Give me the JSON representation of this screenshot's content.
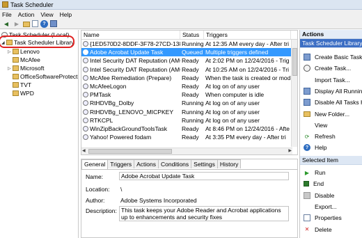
{
  "window": {
    "title": "Task Scheduler"
  },
  "menu": [
    "File",
    "Action",
    "View",
    "Help"
  ],
  "tree": {
    "root": "Task Scheduler (Local)",
    "library": "Task Scheduler Library",
    "children": [
      "Lenovo",
      "McAfee",
      "Microsoft",
      "OfficeSoftwareProtect",
      "TVT",
      "WPD"
    ]
  },
  "list": {
    "headers": {
      "name": "Name",
      "status": "Status",
      "triggers": "Triggers"
    },
    "rows": [
      {
        "name": "{1ED570D2-8DDF-3F78-27CD-1385...",
        "status": "Running",
        "triggers": "At 12:35 AM every day - After tri"
      },
      {
        "name": "Adobe Acrobat Update Task",
        "status": "Queued",
        "triggers": "Multiple triggers defined"
      },
      {
        "name": "Intel Security DAT Reputation (AMC...",
        "status": "Ready",
        "triggers": "At 2:02 PM on 12/24/2016 - Trig"
      },
      {
        "name": "Intel Security DAT Reputation (AMC...",
        "status": "Ready",
        "triggers": "At 10:25 AM on 12/24/2016 - Tri"
      },
      {
        "name": "McAfee Remediation (Prepare)",
        "status": "Ready",
        "triggers": "When the task is created or mod"
      },
      {
        "name": "McAfeeLogon",
        "status": "Ready",
        "triggers": "At log on of any user"
      },
      {
        "name": "PMTask",
        "status": "Ready",
        "triggers": "When computer is idle"
      },
      {
        "name": "RtHDVBg_Dolby",
        "status": "Running",
        "triggers": "At log on of any user"
      },
      {
        "name": "RtHDVBg_LENOVO_MICPKEY",
        "status": "Running",
        "triggers": "At log on of any user"
      },
      {
        "name": "RTKCPL",
        "status": "Running",
        "triggers": "At log on of any user"
      },
      {
        "name": "WinZipBackGroundToolsTask",
        "status": "Ready",
        "triggers": "At 8:46 PM on 12/24/2016 - Afte"
      },
      {
        "name": "Yahoo! Powered fodam",
        "status": "Ready",
        "triggers": "At 3:35 PM every day - After tri"
      }
    ],
    "selected_index": 1
  },
  "details": {
    "tabs": [
      "General",
      "Triggers",
      "Actions",
      "Conditions",
      "Settings",
      "History"
    ],
    "active_tab": "General",
    "name_label": "Name:",
    "name_value": "Adobe Acrobat Update Task",
    "location_label": "Location:",
    "location_value": "\\",
    "author_label": "Author:",
    "author_value": "Adobe Systems Incorporated",
    "description_label": "Description:",
    "description_value": "This task keeps your Adobe Reader and Acrobat applications up to enhancements and security fixes"
  },
  "actions": {
    "header": "Actions",
    "section_library": "Task Scheduler Library",
    "library_items": [
      {
        "label": "Create Basic Task...",
        "icon": "basic-task-icon"
      },
      {
        "label": "Create Task...",
        "icon": "create-task-icon"
      },
      {
        "label": "Import Task...",
        "icon": "none"
      },
      {
        "label": "Display All Running",
        "icon": "display-running-icon"
      },
      {
        "label": "Disable All Tasks Hi",
        "icon": "disable-history-icon"
      },
      {
        "label": "New Folder...",
        "icon": "folder-icon"
      },
      {
        "label": "View",
        "icon": "none"
      },
      {
        "label": "Refresh",
        "icon": "refresh-icon"
      },
      {
        "label": "Help",
        "icon": "help-icon"
      }
    ],
    "section_selected": "Selected Item",
    "selected_items": [
      {
        "label": "Run",
        "icon": "run-icon"
      },
      {
        "label": "End",
        "icon": "end-icon"
      },
      {
        "label": "Disable",
        "icon": "disable-icon"
      },
      {
        "label": "Export...",
        "icon": "none"
      },
      {
        "label": "Properties",
        "icon": "properties-icon"
      },
      {
        "label": "Delete",
        "icon": "delete-icon"
      }
    ]
  },
  "colors": {
    "selection": "#3399ff",
    "callout_ring": "#e02020",
    "actions_selected": "#3c6ec4"
  }
}
